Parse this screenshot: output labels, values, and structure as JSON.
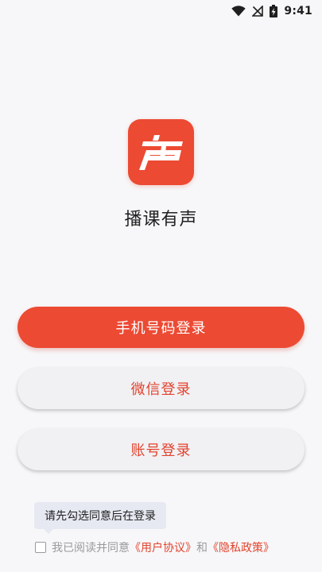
{
  "status_bar": {
    "time": "9:41",
    "icons": [
      "wifi-icon",
      "no-signal-icon",
      "battery-charging-icon"
    ]
  },
  "app": {
    "logo_char": "声",
    "name": "播课有声"
  },
  "buttons": {
    "phone_login": "手机号码登录",
    "wechat_login": "微信登录",
    "account_login": "账号登录"
  },
  "agreement": {
    "tooltip": "请先勾选同意后在登录",
    "prefix": "我已阅读并同意",
    "user_agreement": "《用户协议》",
    "conjunction": "和",
    "privacy_policy": "《隐私政策》",
    "checked": false
  },
  "colors": {
    "brand": "#ec4a33",
    "link": "#e2432d",
    "background": "#f7f7f9",
    "secondary_button": "#f1f1f4",
    "tooltip_bg": "#e6e9f2"
  }
}
